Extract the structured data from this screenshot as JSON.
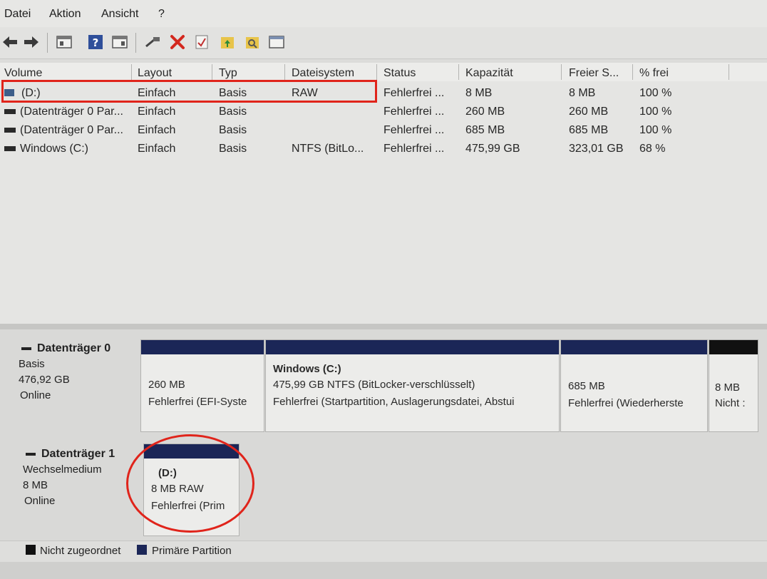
{
  "menu": {
    "file": "Datei",
    "action": "Aktion",
    "view": "Ansicht",
    "help": "?"
  },
  "toolbar": {
    "icons": [
      "back-icon",
      "forward-icon",
      "console-tree-icon",
      "help-icon",
      "properties-icon",
      "connect-icon",
      "delete-icon",
      "check-icon",
      "folder-up-icon",
      "search-folder-icon",
      "window-icon"
    ],
    "colors": {
      "delete": "#d3281e",
      "help": "#2f4f9a",
      "folder": "#e8c44a"
    }
  },
  "volume_list": {
    "columns": [
      "Volume",
      "Layout",
      "Typ",
      "Dateisystem",
      "Status",
      "Kapazität",
      "Freier S...",
      "% frei"
    ],
    "rows": [
      {
        "volume": "(D:)",
        "layout": "Einfach",
        "type": "Basis",
        "fs": "RAW",
        "status": "Fehlerfrei ...",
        "capacity": "8 MB",
        "free": "8 MB",
        "pct": "100 %"
      },
      {
        "volume": "(Datenträger 0 Par...",
        "layout": "Einfach",
        "type": "Basis",
        "fs": "",
        "status": "Fehlerfrei ...",
        "capacity": "260 MB",
        "free": "260 MB",
        "pct": "100 %"
      },
      {
        "volume": "(Datenträger 0 Par...",
        "layout": "Einfach",
        "type": "Basis",
        "fs": "",
        "status": "Fehlerfrei ...",
        "capacity": "685 MB",
        "free": "685 MB",
        "pct": "100 %"
      },
      {
        "volume": "Windows (C:)",
        "layout": "Einfach",
        "type": "Basis",
        "fs": "NTFS (BitLo...",
        "status": "Fehlerfrei ...",
        "capacity": "475,99 GB",
        "free": "323,01 GB",
        "pct": "68 %"
      }
    ]
  },
  "disks": [
    {
      "name": "Datenträger 0",
      "kind": "Basis",
      "size": "476,92 GB",
      "state": "Online",
      "partitions": [
        {
          "size": "260 MB",
          "status": "Fehlerfrei (EFI-Syste"
        },
        {
          "title": "Windows  (C:)",
          "size": "475,99 GB NTFS (BitLocker-verschlüsselt)",
          "status": "Fehlerfrei (Startpartition, Auslagerungsdatei, Abstui"
        },
        {
          "size": "685 MB",
          "status": "Fehlerfrei (Wiederherste"
        },
        {
          "size": "8 MB",
          "status": "Nicht :"
        }
      ]
    },
    {
      "name": "Datenträger 1",
      "kind": "Wechselmedium",
      "size": "8 MB",
      "state": "Online",
      "partitions": [
        {
          "title": "(D:)",
          "size": "8 MB RAW",
          "status": "Fehlerfrei (Prim"
        }
      ]
    }
  ],
  "legend": {
    "unallocated": "Nicht zugeordnet",
    "primary": "Primäre Partition",
    "unallocated_color": "#111111",
    "primary_color": "#1b2657"
  },
  "annotation_color": "#e0241b"
}
